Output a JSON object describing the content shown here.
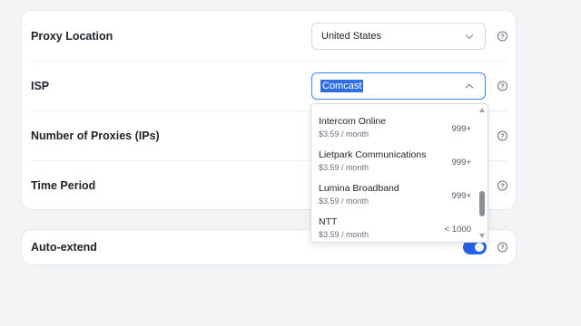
{
  "settings": {
    "proxy_location": {
      "label": "Proxy Location",
      "value": "United States"
    },
    "isp": {
      "label": "ISP",
      "value": "Comcast"
    },
    "num_proxies": {
      "label": "Number of Proxies (IPs)"
    },
    "time_period": {
      "label": "Time Period"
    },
    "auto_extend": {
      "label": "Auto-extend",
      "enabled": true
    }
  },
  "help_icon_glyph": "?",
  "isp_dropdown": {
    "options": [
      {
        "name": "Intercom Online",
        "price": "$3.59 / month",
        "count": "999+"
      },
      {
        "name": "Lietpark Communications",
        "price": "$3.59 / month",
        "count": "999+"
      },
      {
        "name": "Lumina Broadband",
        "price": "$3.59 / month",
        "count": "999+"
      },
      {
        "name": "NTT",
        "price": "$3.59 / month",
        "count": "< 1000"
      }
    ]
  },
  "colors": {
    "accent": "#2563eb",
    "highlight": "#2f6fe4"
  }
}
